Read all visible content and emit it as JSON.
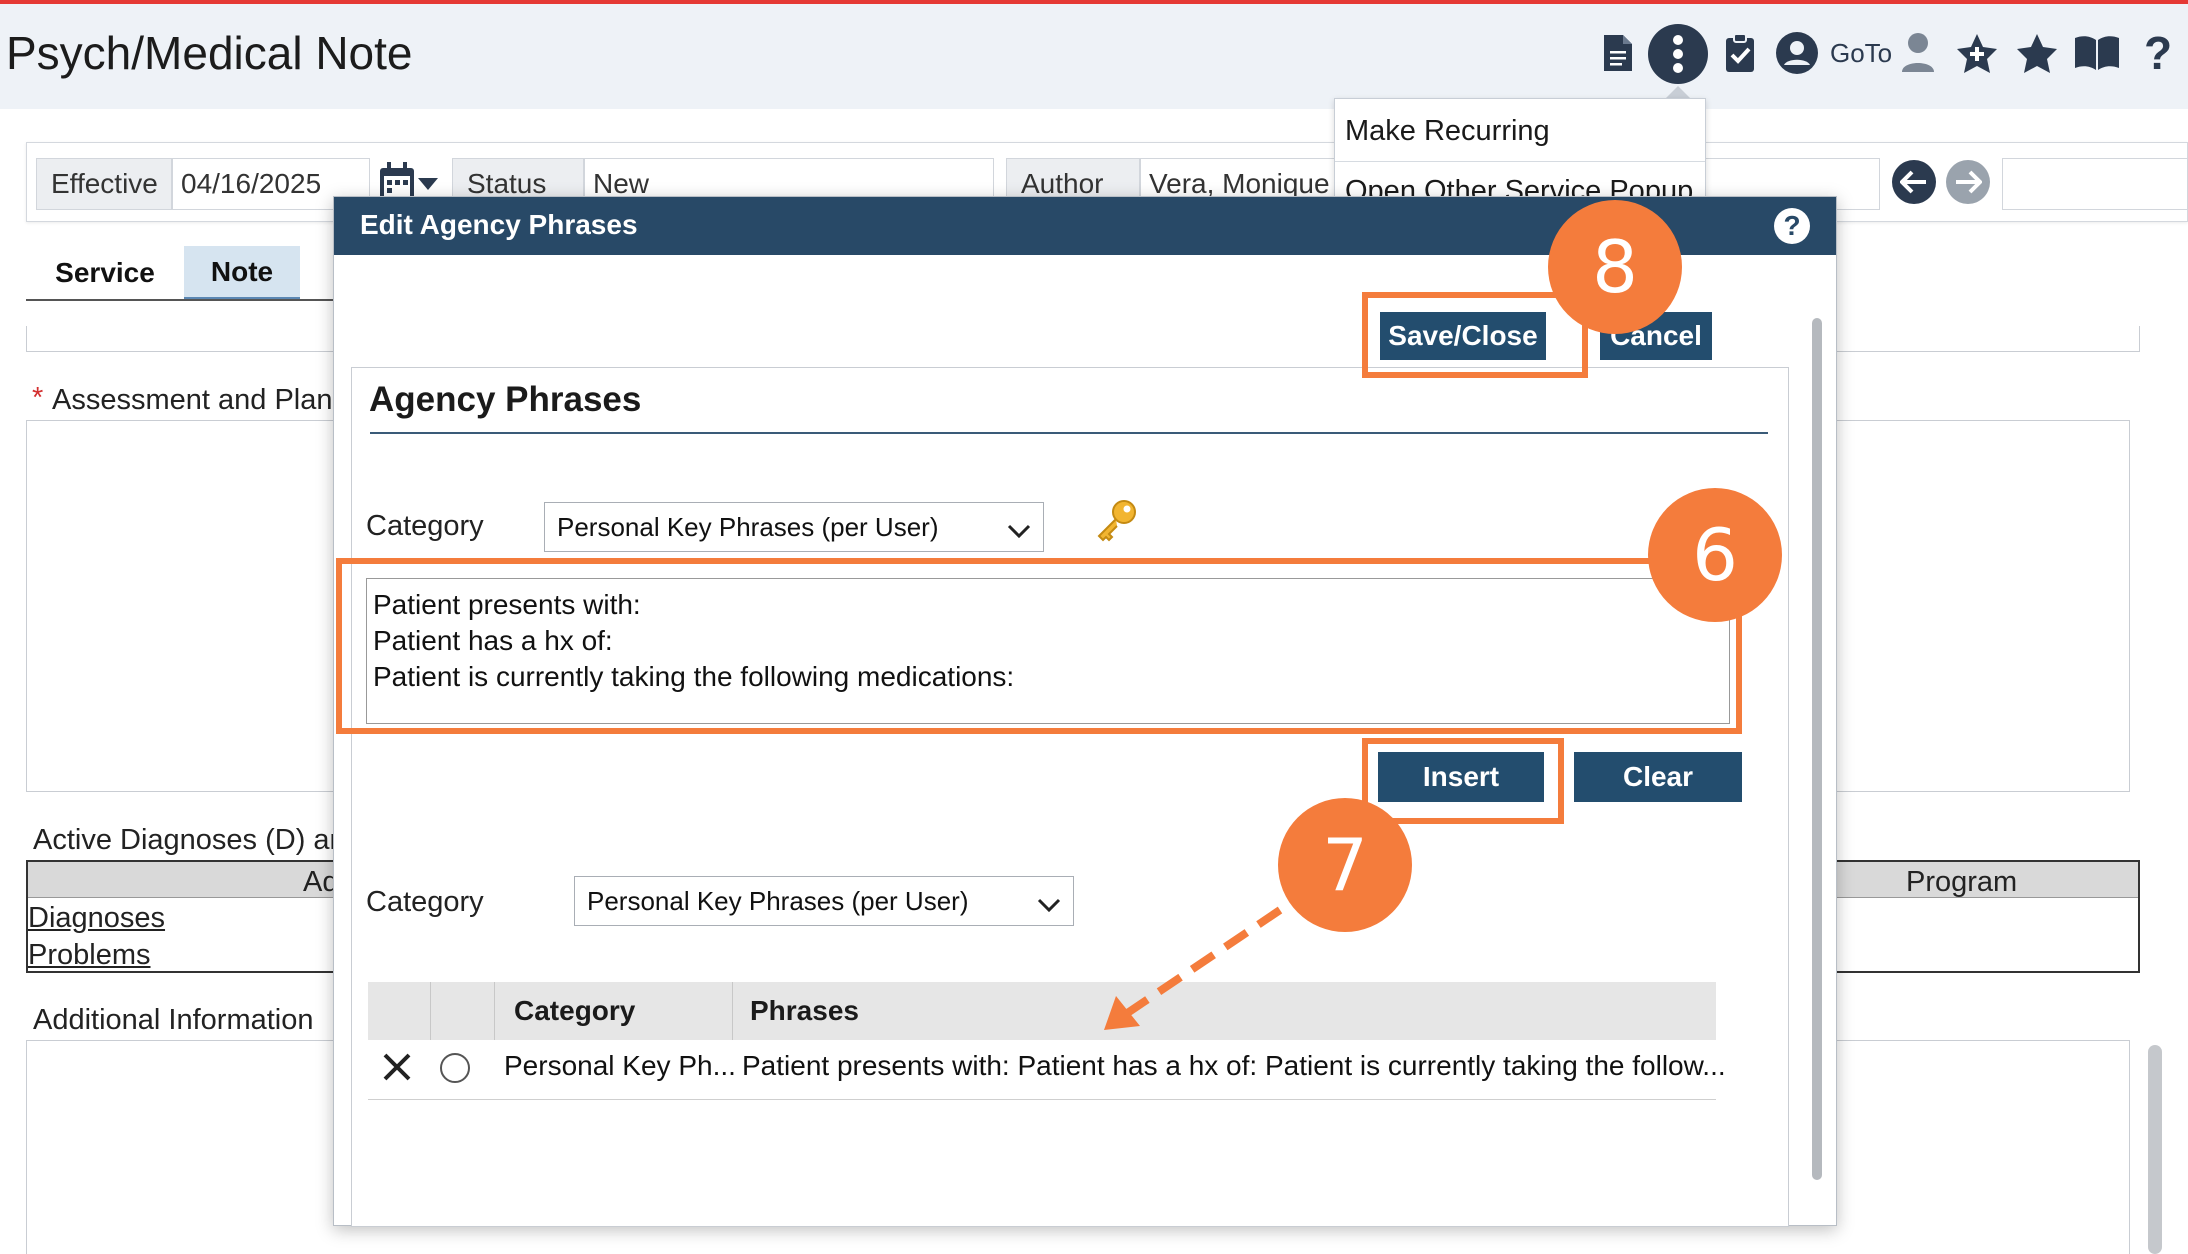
{
  "header": {
    "title": "Psych/Medical Note",
    "goto_label": "GoTo",
    "icons": [
      "document-icon",
      "more-vertical-icon",
      "clipboard-check-icon",
      "user-circle-icon",
      "person-icon",
      "star-plus-icon",
      "star-icon",
      "book-icon",
      "help-icon"
    ]
  },
  "actions_menu": {
    "items": [
      "Make Recurring",
      "Open Other Service Popup"
    ]
  },
  "toolbar": {
    "effective_label": "Effective",
    "effective_value": "04/16/2025",
    "status_label": "Status",
    "status_value": "New",
    "author_label": "Author",
    "author_value": "Vera, Monique"
  },
  "tabs": [
    "Service",
    "Note"
  ],
  "background": {
    "assessment_label": "Assessment and Plan",
    "required_marker": "*",
    "active_diagnoses_label": "Active Diagnoses (D) anc",
    "table_header_fragment": "Ad",
    "program_header": "Program",
    "links": [
      "Diagnoses",
      "Problems"
    ],
    "additional_label": "Additional Information"
  },
  "modal": {
    "title": "Edit Agency Phrases",
    "help_icon": "?",
    "save_close": "Save/Close",
    "cancel": "Cancel",
    "panel_title": "Agency Phrases",
    "category_label": "Category",
    "category_value": "Personal Key Phrases (per User)",
    "phrase_lines": [
      "Patient presents with:",
      "Patient has a hx of:",
      "Patient is currently taking the following medications:"
    ],
    "insert": "Insert",
    "clear": "Clear",
    "filter_category_label": "Category",
    "filter_category_value": "Personal Key Phrases (per User)",
    "grid": {
      "headers": [
        "Category",
        "Phrases"
      ],
      "rows": [
        {
          "category": "Personal Key Ph...",
          "phrase": "Patient presents with: Patient has a hx of: Patient is currently taking the follow..."
        }
      ]
    }
  },
  "annotations": {
    "step_6": "6",
    "step_7": "7",
    "step_8": "8",
    "accent_color": "#f47c3c"
  },
  "colors": {
    "modal_titlebar": "#284967",
    "button": "#234d6e",
    "header_bg": "#eef2f7",
    "top_line": "#e53935"
  }
}
